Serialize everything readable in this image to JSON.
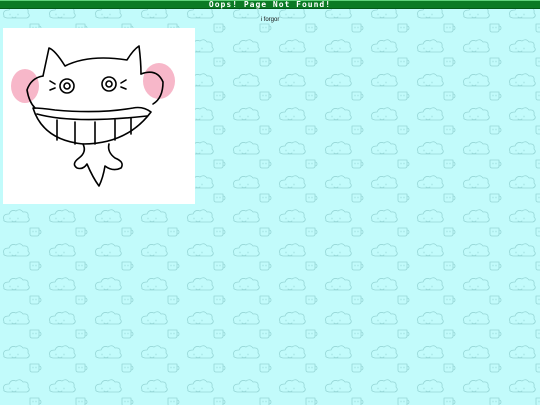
{
  "page": {
    "title": "Oops! Page Not Found!",
    "message": "i forgor"
  },
  "colors": {
    "background": "#c2fbfb",
    "pattern": "#9fdede",
    "title_bar": "#0b7a24",
    "title_text": "#ffffff",
    "blush": "#f7b7c9"
  },
  "icons": {
    "background_pattern": "cloud-doodle-icon",
    "illustration": "grinning-cat-doodle"
  }
}
